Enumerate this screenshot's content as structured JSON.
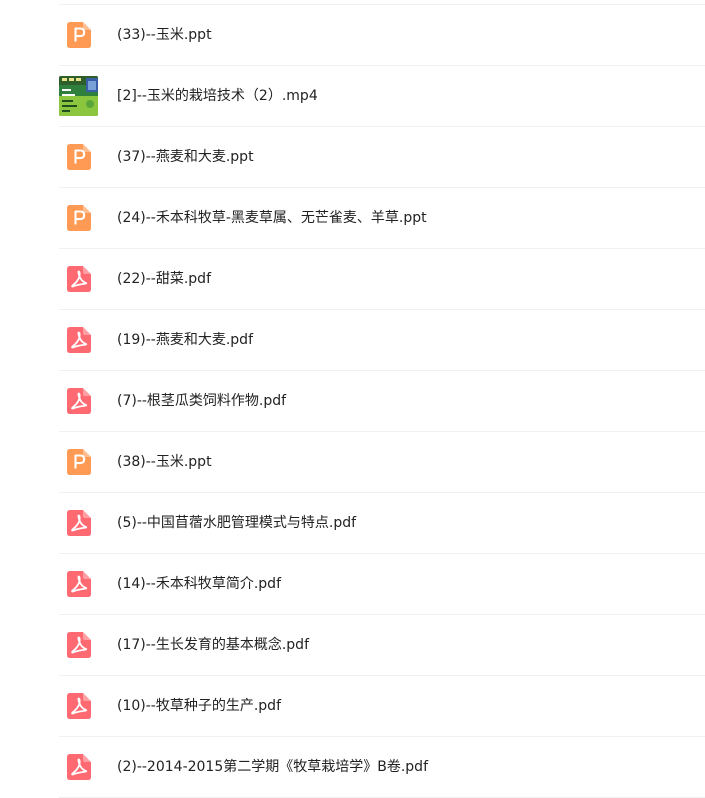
{
  "colors": {
    "ppt_icon": "#ff9a55",
    "pdf_icon": "#ff6a72",
    "divider": "#f1f1f1",
    "text": "#222222"
  },
  "files": [
    {
      "name": "(33)--玉米.ppt",
      "type": "ppt",
      "icon": "ppt-icon"
    },
    {
      "name": "[2]--玉米的栽培技术（2）.mp4",
      "type": "mp4",
      "icon": "video-thumbnail"
    },
    {
      "name": "(37)--燕麦和大麦.ppt",
      "type": "ppt",
      "icon": "ppt-icon"
    },
    {
      "name": "(24)--禾本科牧草-黑麦草属、无芒雀麦、羊草.ppt",
      "type": "ppt",
      "icon": "ppt-icon"
    },
    {
      "name": "(22)--甜菜.pdf",
      "type": "pdf",
      "icon": "pdf-icon"
    },
    {
      "name": "(19)--燕麦和大麦.pdf",
      "type": "pdf",
      "icon": "pdf-icon"
    },
    {
      "name": "(7)--根茎瓜类饲料作物.pdf",
      "type": "pdf",
      "icon": "pdf-icon"
    },
    {
      "name": "(38)--玉米.ppt",
      "type": "ppt",
      "icon": "ppt-icon"
    },
    {
      "name": "(5)--中国苜蓿水肥管理模式与特点.pdf",
      "type": "pdf",
      "icon": "pdf-icon"
    },
    {
      "name": "(14)--禾本科牧草简介.pdf",
      "type": "pdf",
      "icon": "pdf-icon"
    },
    {
      "name": "(17)--生长发育的基本概念.pdf",
      "type": "pdf",
      "icon": "pdf-icon"
    },
    {
      "name": "(10)--牧草种子的生产.pdf",
      "type": "pdf",
      "icon": "pdf-icon"
    },
    {
      "name": "(2)--2014-2015第二学期《牧草栽培学》B卷.pdf",
      "type": "pdf",
      "icon": "pdf-icon"
    }
  ]
}
